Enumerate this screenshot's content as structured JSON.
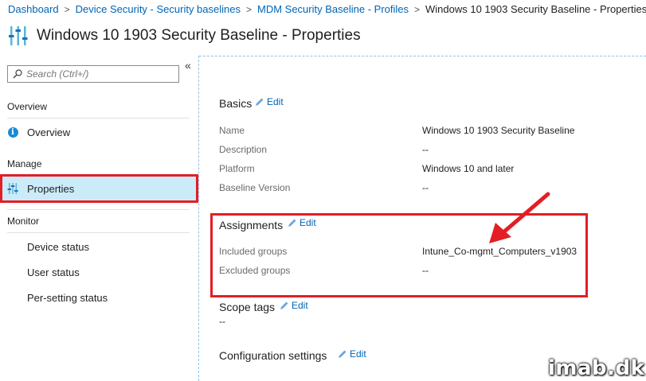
{
  "breadcrumb": {
    "items": [
      "Dashboard",
      "Device Security - Security baselines",
      "MDM Security Baseline - Profiles"
    ],
    "current": "Windows 10 1903 Security Baseline - Properties",
    "separator": ">"
  },
  "page": {
    "title": "Windows 10 1903 Security Baseline - Properties",
    "icon": "sliders-icon"
  },
  "sidebar": {
    "search_placeholder": "Search (Ctrl+/)",
    "collapse_label": "«",
    "sections": [
      {
        "heading": "Overview",
        "items": [
          {
            "label": "Overview",
            "icon": "info-icon"
          }
        ]
      },
      {
        "heading": "Manage",
        "items": [
          {
            "label": "Properties",
            "icon": "sliders-icon",
            "selected": true
          }
        ]
      },
      {
        "heading": "Monitor",
        "items": [
          {
            "label": "Device status"
          },
          {
            "label": "User status"
          },
          {
            "label": "Per-setting status"
          }
        ]
      }
    ]
  },
  "basics": {
    "title": "Basics",
    "edit": "Edit",
    "rows": [
      {
        "label": "Name",
        "value": "Windows 10 1903 Security Baseline"
      },
      {
        "label": "Description",
        "value": "--"
      },
      {
        "label": "Platform",
        "value": "Windows 10 and later"
      },
      {
        "label": "Baseline Version",
        "value": "--"
      }
    ]
  },
  "assignments": {
    "title": "Assignments",
    "edit": "Edit",
    "rows": [
      {
        "label": "Included groups",
        "value": "Intune_Co-mgmt_Computers_v1903"
      },
      {
        "label": "Excluded groups",
        "value": "--"
      }
    ]
  },
  "scope_tags": {
    "title": "Scope tags",
    "edit": "Edit",
    "value": "--"
  },
  "configuration": {
    "title": "Configuration settings",
    "edit": "Edit"
  },
  "watermark": "imab.dk",
  "colors": {
    "accent": "#0064b4",
    "highlight": "#e31e24",
    "selected_bg": "#ccebf9"
  }
}
